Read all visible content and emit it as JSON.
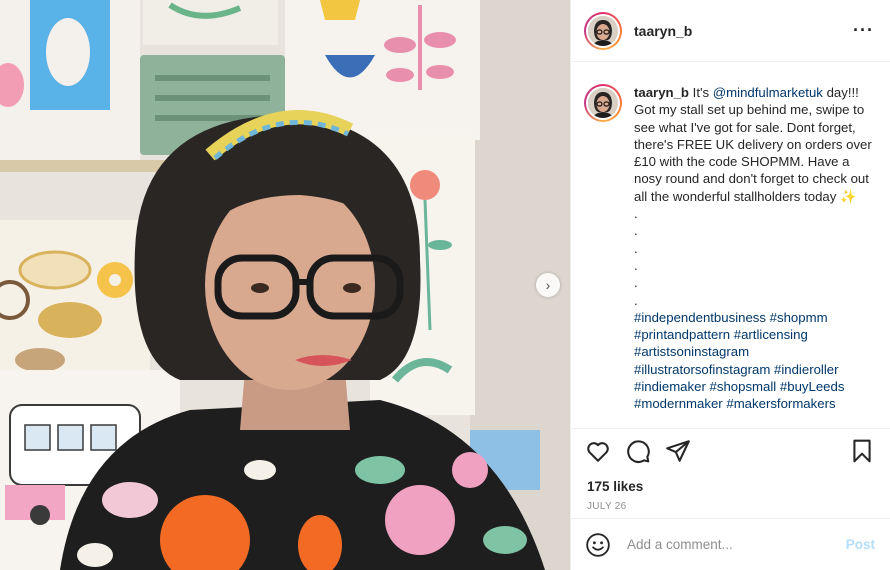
{
  "post": {
    "username": "taaryn_b",
    "more_icon": "more-horizontal-icon"
  },
  "caption": {
    "username": "taaryn_b",
    "intro": "It's ",
    "mention": "@mindfulmarketuk",
    "body": " day!!! Got my stall set up behind me, swipe to see what I've got for sale. Dont forget, there's FREE UK delivery on orders over £10 with the code SHOPMM. Have a nosy round and don't forget to check out all the wonderful stallholders today ✨",
    "dots": [
      ".",
      ".",
      ".",
      ".",
      ".",
      "."
    ],
    "hashtags": [
      "#independentbusiness",
      "#shopmm",
      "#printandpattern",
      "#artlicensing",
      "#artistsoninstagram",
      "#illustratorsofinstagram",
      "#indieroller",
      "#indiemaker",
      "#shopsmall",
      "#buyLeeds",
      "#modernmaker",
      "#makersformakers"
    ]
  },
  "actions": {
    "like_icon": "heart-icon",
    "comment_icon": "comment-icon",
    "share_icon": "send-icon",
    "save_icon": "bookmark-icon",
    "likes": "175 likes",
    "date": "JULY 26"
  },
  "comment_box": {
    "placeholder": "Add a comment...",
    "post_label": "Post",
    "emoji_icon": "emoji-icon"
  },
  "carousel": {
    "next_icon": "chevron-right-icon",
    "next_glyph": "›"
  },
  "colors": {
    "link": "#00376b",
    "post_disabled": "#b2dffc",
    "muted": "#8e8e8e"
  }
}
